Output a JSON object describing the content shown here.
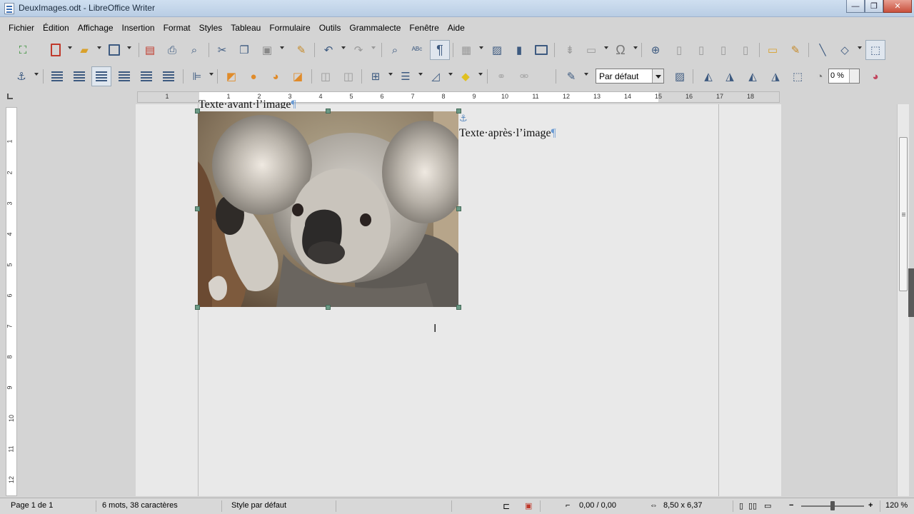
{
  "window": {
    "title": "DeuxImages.odt - LibreOffice Writer",
    "min": "—",
    "max": "❐",
    "close": "✕"
  },
  "menu": [
    "Fichier",
    "Édition",
    "Affichage",
    "Insertion",
    "Format",
    "Styles",
    "Tableau",
    "Formulaire",
    "Outils",
    "Grammalecte",
    "Fenêtre",
    "Aide"
  ],
  "toolbar2": {
    "style_value": "Par défaut",
    "percent_value": "0 %"
  },
  "ruler": {
    "h_labels": [
      "1",
      "1",
      "2",
      "3",
      "4",
      "5",
      "6",
      "7",
      "8",
      "9",
      "10",
      "11",
      "12",
      "13",
      "14",
      "15",
      "16",
      "17",
      "18"
    ],
    "v_labels": [
      "1",
      "2",
      "3",
      "4",
      "5",
      "6",
      "7",
      "8",
      "9",
      "10",
      "11",
      "12"
    ]
  },
  "document": {
    "text_before": "Texte·avant·l’image",
    "text_after": "Texte·après·l’image",
    "pilcrow": "¶",
    "image_alt": "koala"
  },
  "status": {
    "page": "Page 1 de 1",
    "words": "6 mots, 38 caractères",
    "style": "Style par défaut",
    "position": "0,00 / 0,00",
    "size": "8,50 x 6,37",
    "zoom": "120 %"
  },
  "colors": {
    "accent": "#3d5a80",
    "page": "#e9e9e9",
    "background": "#d4d4d4",
    "handles": "#6c9a86"
  }
}
